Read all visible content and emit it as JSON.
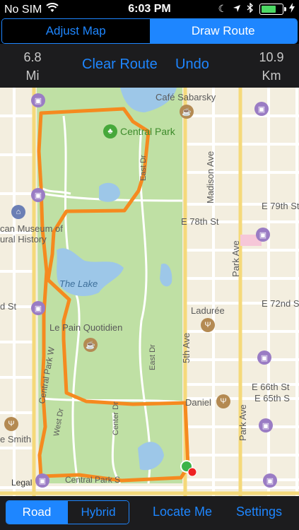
{
  "status": {
    "carrier": "No SIM",
    "time": "6:03 PM",
    "battery_level": 0.7,
    "battery_color": "#4cd964"
  },
  "top_tabs": [
    {
      "label": "Adjust Map",
      "selected": false
    },
    {
      "label": "Draw Route",
      "selected": true
    }
  ],
  "metrics": {
    "miles_value": "6.8",
    "miles_unit": "Mi",
    "km_value": "10.9",
    "km_unit": "Km"
  },
  "actions": {
    "clear_route": "Clear Route",
    "undo": "Undo"
  },
  "map": {
    "labels": {
      "cafe": "Café Sabarsky",
      "central_park": "Central Park",
      "madison_ave": "Madison Ave",
      "e79": "E 79th St",
      "e78": "E 78th St",
      "museum": "can Museum of\nural History",
      "park_ave": "Park Ave",
      "the_lake": "The Lake",
      "d_st": "d St",
      "laduree": "Ladurée",
      "e72": "E 72nd S",
      "le_pain": "Le Pain Quotidien",
      "fifth_ave": "5th Ave",
      "east_dr": "East Dr",
      "central_park_w": "Central Park W",
      "west_dr": "West Dr",
      "center_dr": "Center Dr",
      "e66": "E 66th St",
      "daniel": "Daniel",
      "e65": "E 65th S",
      "smith": "e Smith",
      "legal": "Legal",
      "central_park_s": "Central Park S",
      "park_ave_2": "Park Ave",
      "east_dr_top": "East Dr"
    },
    "colors": {
      "park": "#bfe0a4",
      "water": "#9dc7e8",
      "route": "#f58a1f",
      "street": "#ffffff",
      "block": "#f3eedf"
    }
  },
  "bottom": {
    "map_types": [
      {
        "label": "Road",
        "selected": true
      },
      {
        "label": "Hybrid",
        "selected": false
      }
    ],
    "locate_me": "Locate Me",
    "settings": "Settings"
  }
}
